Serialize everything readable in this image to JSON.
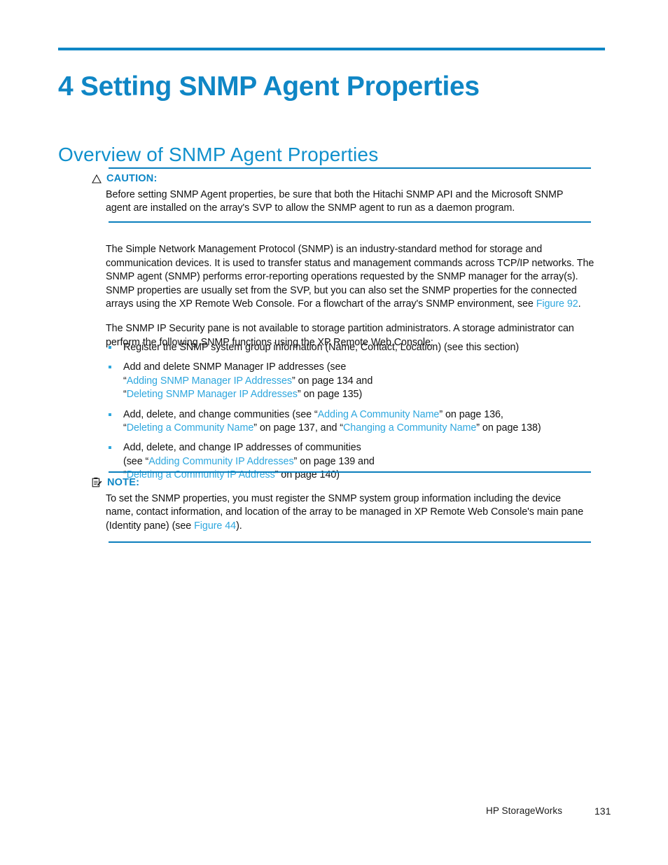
{
  "chapter": {
    "number": "4",
    "title": "4 Setting SNMP Agent Properties"
  },
  "section": {
    "heading": "Overview of SNMP Agent Properties"
  },
  "colors": {
    "chapter_blue": "#0f86c5",
    "heading_blue": "#1090cc",
    "link_blue": "#2ea7de",
    "rule_blue": "#0c7fbd",
    "body_text": "#111111"
  },
  "caution": {
    "icon": "caution-triangle-icon",
    "label": "CAUTION:",
    "text": "Before setting SNMP Agent properties, be sure that both the Hitachi SNMP API and the Microsoft SNMP agent are installed on the array's SVP to allow the SNMP agent to run as a daemon program."
  },
  "note": {
    "icon": "note-clipboard-icon",
    "label": "NOTE:",
    "text_before_link": "To set the SNMP properties, you must register the SNMP system group information including the device name, contact information, and location of the array to be managed in XP Remote Web Console's main pane (Identity pane) (see ",
    "link": "Figure 44",
    "text_after_link": ")."
  },
  "paragraphs": {
    "p1_before_link": "The Simple Network Management Protocol (SNMP) is an industry-standard method for storage and communication devices. It is used to transfer status and management commands across TCP/IP networks. The SNMP agent (SNMP) performs error-reporting operations requested by the SNMP manager for the array(s).  SNMP properties are usually set from the SVP, but you can also set the SNMP properties for the connected arrays using the XP Remote Web Console.  For a flowchart of the array's SNMP environment, see ",
    "p1_link": "Figure 92",
    "p1_after_link": ".",
    "p2": "The SNMP IP Security pane is not available to storage partition administrators.  A storage administrator can perform the following SNMP functions using the XP Remote Web Console:"
  },
  "bullets": [
    {
      "lines": [
        {
          "segments": [
            {
              "text": "Register the SNMP system group information (Name, Contact, Location) (see this section)",
              "link": false
            }
          ]
        }
      ]
    },
    {
      "lines": [
        {
          "segments": [
            {
              "text": "Add  and  delete  SNMP  Manager  IP  addresses  (see",
              "link": false
            }
          ]
        },
        {
          "segments": [
            {
              "text": "“",
              "link": false
            },
            {
              "text": "Adding  SNMP  Manager  IP  Addresses",
              "link": true
            },
            {
              "text": "”  on  page  134  and",
              "link": false
            }
          ]
        },
        {
          "segments": [
            {
              "text": "“",
              "link": false
            },
            {
              "text": "Deleting SNMP Manager IP Addresses",
              "link": true
            },
            {
              "text": "” on page 135)",
              "link": false
            }
          ]
        }
      ]
    },
    {
      "lines": [
        {
          "segments": [
            {
              "text": "Add, delete, and change communities (see “",
              "link": false
            },
            {
              "text": "Adding A Community Name",
              "link": true
            },
            {
              "text": "” on page 136,",
              "link": false
            }
          ]
        },
        {
          "segments": [
            {
              "text": "“",
              "link": false
            },
            {
              "text": "Deleting a Community Name",
              "link": true
            },
            {
              "text": "” on page 137, and “",
              "link": false
            },
            {
              "text": "Changing a Community Name",
              "link": true
            },
            {
              "text": "” on page 138)",
              "link": false
            }
          ]
        }
      ]
    },
    {
      "lines": [
        {
          "segments": [
            {
              "text": "Add,  delete,  and  change  IP  addresses  of  communities",
              "link": false
            }
          ]
        },
        {
          "segments": [
            {
              "text": "(see  “",
              "link": false
            },
            {
              "text": "Adding  Community  IP  Addresses",
              "link": true
            },
            {
              "text": "”  on  page  139  and",
              "link": false
            }
          ]
        },
        {
          "segments": [
            {
              "text": "“",
              "link": false
            },
            {
              "text": "Deleting a Community IP Address",
              "link": true
            },
            {
              "text": "” on page 140)",
              "link": false
            }
          ]
        }
      ]
    }
  ],
  "footer": {
    "brand": "HP StorageWorks",
    "page_number": "131"
  }
}
